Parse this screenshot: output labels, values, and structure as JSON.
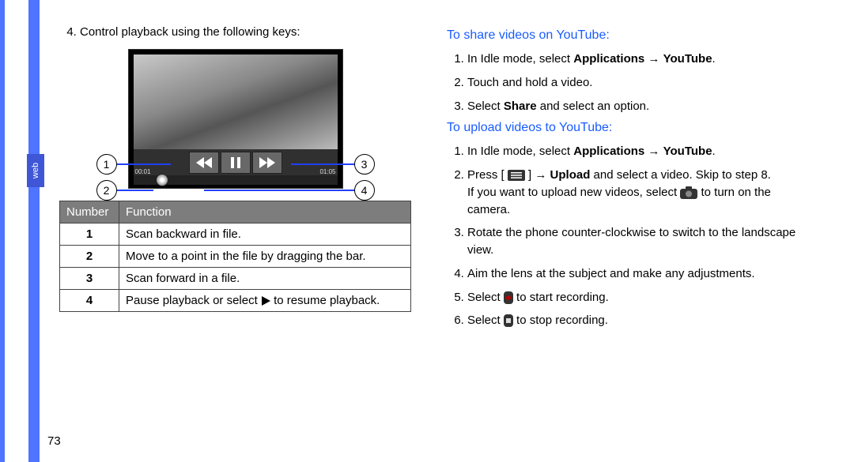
{
  "side_tab": "web",
  "page_number": "73",
  "left": {
    "item4": "Control playback using the following keys:",
    "time_left": "00:01",
    "time_right": "01:05",
    "table": {
      "head_num": "Number",
      "head_fn": "Function",
      "rows": [
        {
          "n": "1",
          "f": "Scan backward in file."
        },
        {
          "n": "2",
          "f": "Move to a point in the file by dragging the bar."
        },
        {
          "n": "3",
          "f": "Scan forward in a file."
        },
        {
          "n": "4",
          "f_before": "Pause playback or select ",
          "f_after": " to resume playback."
        }
      ]
    }
  },
  "right": {
    "share_heading": "To share videos on YouTube:",
    "share": {
      "s1a": "In Idle mode, select ",
      "s1b": "Applications",
      "s1c": " → ",
      "s1d": "YouTube",
      "s1e": ".",
      "s2": "Touch and hold a video.",
      "s3a": "Select ",
      "s3b": "Share",
      "s3c": " and select an option."
    },
    "upload_heading": "To upload videos to YouTube:",
    "upload": {
      "u1a": "In Idle mode, select ",
      "u1b": "Applications",
      "u1c": " → ",
      "u1d": "YouTube",
      "u1e": ".",
      "u2a": "Press [ ",
      "u2b": " ] → ",
      "u2c": "Upload",
      "u2d": " and select a video. Skip to step 8.",
      "u2e": "If you want to upload new videos, select ",
      "u2f": " to turn on the camera.",
      "u3": "Rotate the phone counter-clockwise to switch to the landscape view.",
      "u4": "Aim the lens at the subject and make any adjustments.",
      "u5a": "Select ",
      "u5b": " to start recording.",
      "u6a": "Select ",
      "u6b": " to stop recording."
    }
  }
}
